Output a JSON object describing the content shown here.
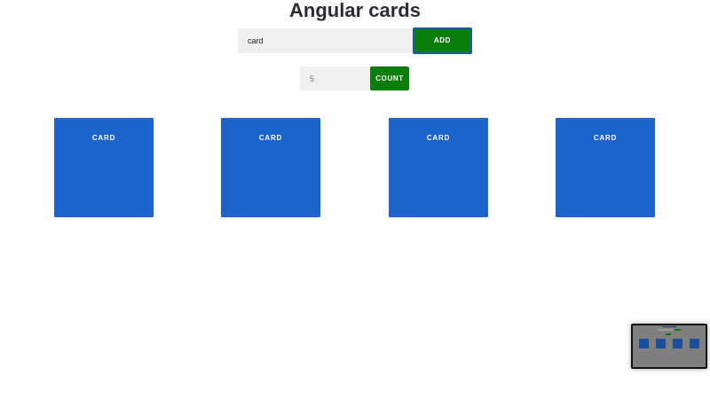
{
  "page": {
    "title": "Angular cards"
  },
  "form": {
    "text_value": "card",
    "add_label": "ADD",
    "count_value": "5",
    "count_label": "COUNT"
  },
  "cards": [
    {
      "label": "CARD"
    },
    {
      "label": "CARD"
    },
    {
      "label": "CARD"
    },
    {
      "label": "CARD"
    }
  ],
  "colors": {
    "button_green": "#0a7d0a",
    "card_blue": "#1c64cc",
    "input_gray": "#efeff1"
  }
}
